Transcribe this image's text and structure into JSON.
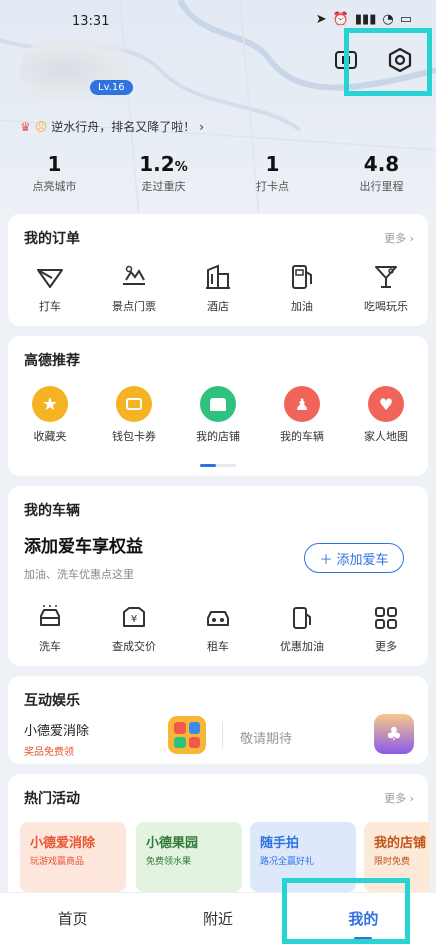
{
  "status_bar": {
    "time": "13:31"
  },
  "profile": {
    "level": "Lv.16"
  },
  "banner": {
    "text": "逆水行舟，排名又降了啦！"
  },
  "stats": [
    {
      "value": "1",
      "label": "点亮城市"
    },
    {
      "value": "1.2",
      "unit": "%",
      "label": "走过重庆"
    },
    {
      "value": "1",
      "label": "打卡点"
    },
    {
      "value": "4.8",
      "label": "出行里程"
    }
  ],
  "orders": {
    "title": "我的订单",
    "more": "更多",
    "items": [
      {
        "label": "打车",
        "icon": "taxi-icon"
      },
      {
        "label": "景点门票",
        "icon": "scenic-ticket-icon"
      },
      {
        "label": "酒店",
        "icon": "hotel-icon"
      },
      {
        "label": "加油",
        "icon": "fuel-icon"
      },
      {
        "label": "吃喝玩乐",
        "icon": "cocktail-icon"
      }
    ]
  },
  "recommend": {
    "title": "高德推荐",
    "items": [
      {
        "label": "收藏夹",
        "icon": "star-icon",
        "color": "#f5b324"
      },
      {
        "label": "钱包卡券",
        "icon": "wallet-icon",
        "color": "#f5b324"
      },
      {
        "label": "我的店铺",
        "icon": "shop-icon",
        "color": "#2fc17e"
      },
      {
        "label": "我的车辆",
        "icon": "car-person-icon",
        "color": "#f0645a"
      },
      {
        "label": "家人地图",
        "icon": "family-map-icon",
        "color": "#f0645a"
      }
    ]
  },
  "vehicle": {
    "title": "我的车辆",
    "headline": "添加爱车享权益",
    "subtext": "加油、洗车优惠点这里",
    "add_button": "添加爱车",
    "items": [
      {
        "label": "洗车",
        "icon": "car-wash-icon"
      },
      {
        "label": "查成交价",
        "icon": "price-icon"
      },
      {
        "label": "租车",
        "icon": "rent-car-icon"
      },
      {
        "label": "优惠加油",
        "icon": "discount-fuel-icon"
      },
      {
        "label": "更多",
        "icon": "grid-more-icon"
      }
    ]
  },
  "entertainment": {
    "title": "互动娱乐",
    "game_name": "小德爱消除",
    "game_sub": "奖品免费领",
    "coming": "敬请期待"
  },
  "activities": {
    "title": "热门活动",
    "more": "更多",
    "cards": [
      {
        "title": "小德爱消除",
        "sub": "玩游戏赢商品",
        "bg": "#fde6dc",
        "color": "#e8542f"
      },
      {
        "title": "小德果园",
        "sub": "免费领水果",
        "bg": "#e3f3df",
        "color": "#2f7a3a"
      },
      {
        "title": "随手拍",
        "sub": "路况全赢好礼",
        "bg": "#dde9fb",
        "color": "#2f73e0"
      },
      {
        "title": "我的店铺",
        "sub": "限时免费",
        "bg": "#fde9d8",
        "color": "#c1551a"
      }
    ]
  },
  "nav": {
    "home": "首页",
    "nearby": "附近",
    "mine": "我的"
  }
}
